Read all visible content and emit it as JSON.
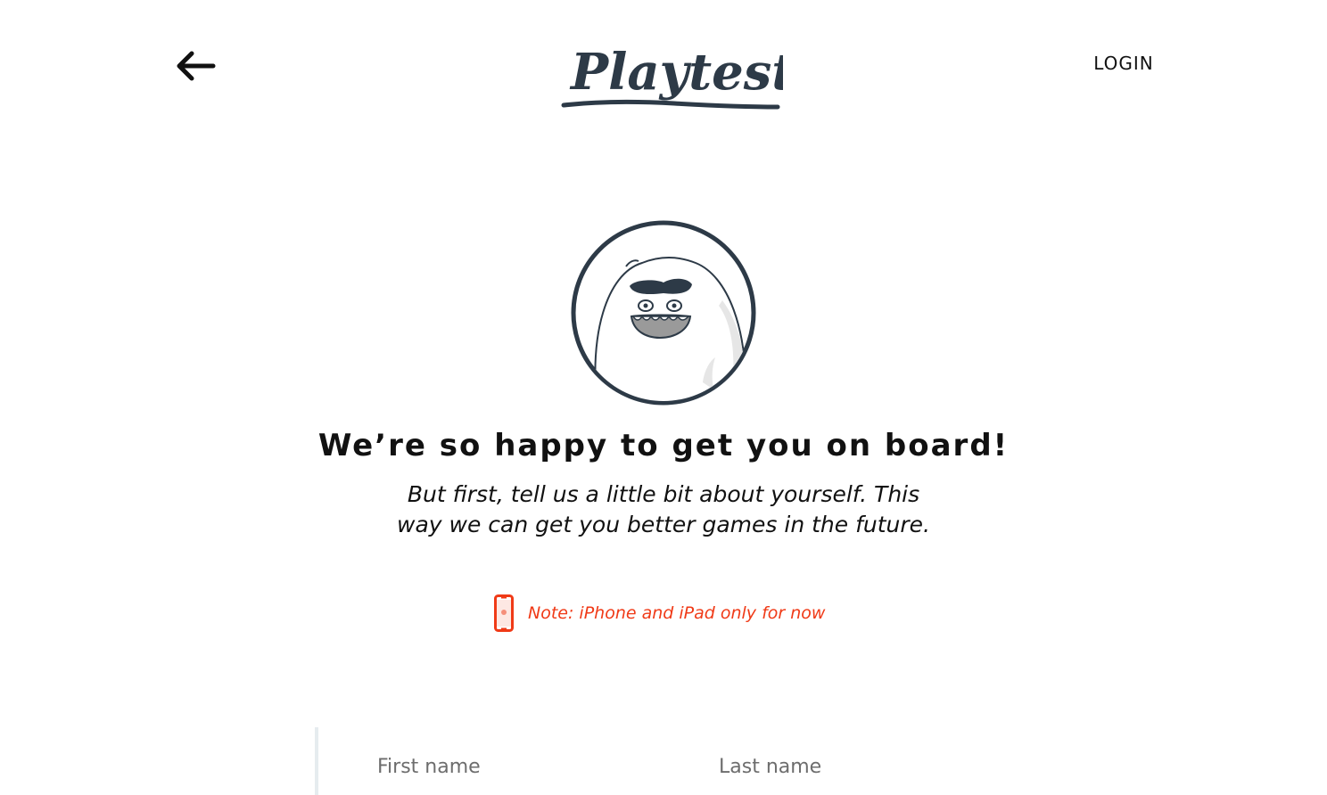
{
  "header": {
    "back_icon": "arrow-left-icon",
    "logo_text": "Playtest",
    "login_label": "LOGIN"
  },
  "hero": {
    "avatar_icon": "yeti-mascot-icon",
    "title": "We’re so happy to get you on board!",
    "subtitle_line1": "But first, tell us a little bit about yourself. This",
    "subtitle_line2": "way we can get you better games in the future."
  },
  "note": {
    "icon": "iphone-icon",
    "text": "Note: iPhone and iPad only for now",
    "color": "#f03a17"
  },
  "form": {
    "first_name_placeholder": "First name",
    "last_name_placeholder": "Last name"
  },
  "colors": {
    "brand_dark": "#2d3a47",
    "accent_red": "#f03a17",
    "background": "#ffffff"
  }
}
